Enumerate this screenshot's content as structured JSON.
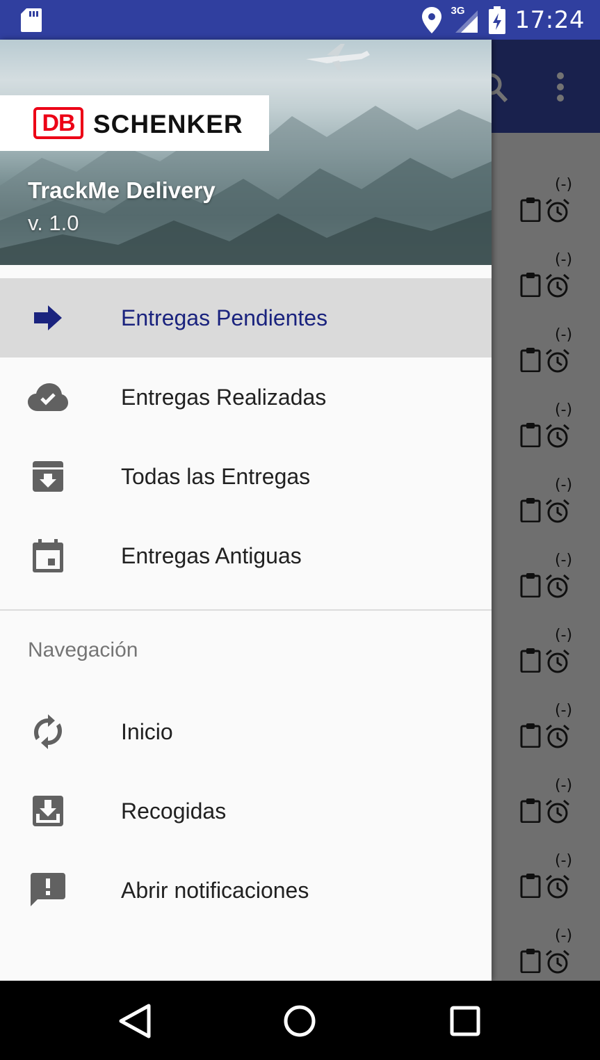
{
  "status_bar": {
    "time": "17:24",
    "network": "3G",
    "icons": [
      "sd-card-icon",
      "location-icon",
      "signal-icon",
      "battery-charging-icon"
    ]
  },
  "background_app": {
    "toolbar_icons": [
      "search-icon",
      "more-vert-icon"
    ],
    "rows": [
      {
        "status": "(-)"
      },
      {
        "status": "(-)"
      },
      {
        "status": "(-)"
      },
      {
        "status": "(-)"
      },
      {
        "status": "(-)"
      },
      {
        "status": "(-)"
      },
      {
        "status": "(-)"
      },
      {
        "status": "(-)"
      },
      {
        "status": "(-)"
      },
      {
        "status": "(-)"
      },
      {
        "status": "(-)"
      }
    ]
  },
  "drawer": {
    "header": {
      "logo_db": "DB",
      "logo_text": "SCHENKER",
      "title": "TrackMe Delivery",
      "version": "v. 1.0"
    },
    "primary_items": [
      {
        "label": "Entregas Pendientes",
        "icon": "arrow-forward-icon",
        "active": true
      },
      {
        "label": "Entregas Realizadas",
        "icon": "cloud-done-icon",
        "active": false
      },
      {
        "label": "Todas las Entregas",
        "icon": "archive-icon",
        "active": false
      },
      {
        "label": "Entregas Antiguas",
        "icon": "calendar-icon",
        "active": false
      }
    ],
    "section_title": "Navegación",
    "secondary_items": [
      {
        "label": "Inicio",
        "icon": "sync-icon"
      },
      {
        "label": "Recogidas",
        "icon": "download-box-icon"
      },
      {
        "label": "Abrir notificaciones",
        "icon": "feedback-icon"
      }
    ]
  },
  "nav_bar": {
    "buttons": [
      "back-icon",
      "home-icon",
      "recents-icon"
    ]
  },
  "colors": {
    "status_bar": "#303f9f",
    "toolbar": "#3949ab",
    "active_item_text": "#1a237e",
    "active_item_bg": "#dadada",
    "db_red": "#ec0016"
  }
}
